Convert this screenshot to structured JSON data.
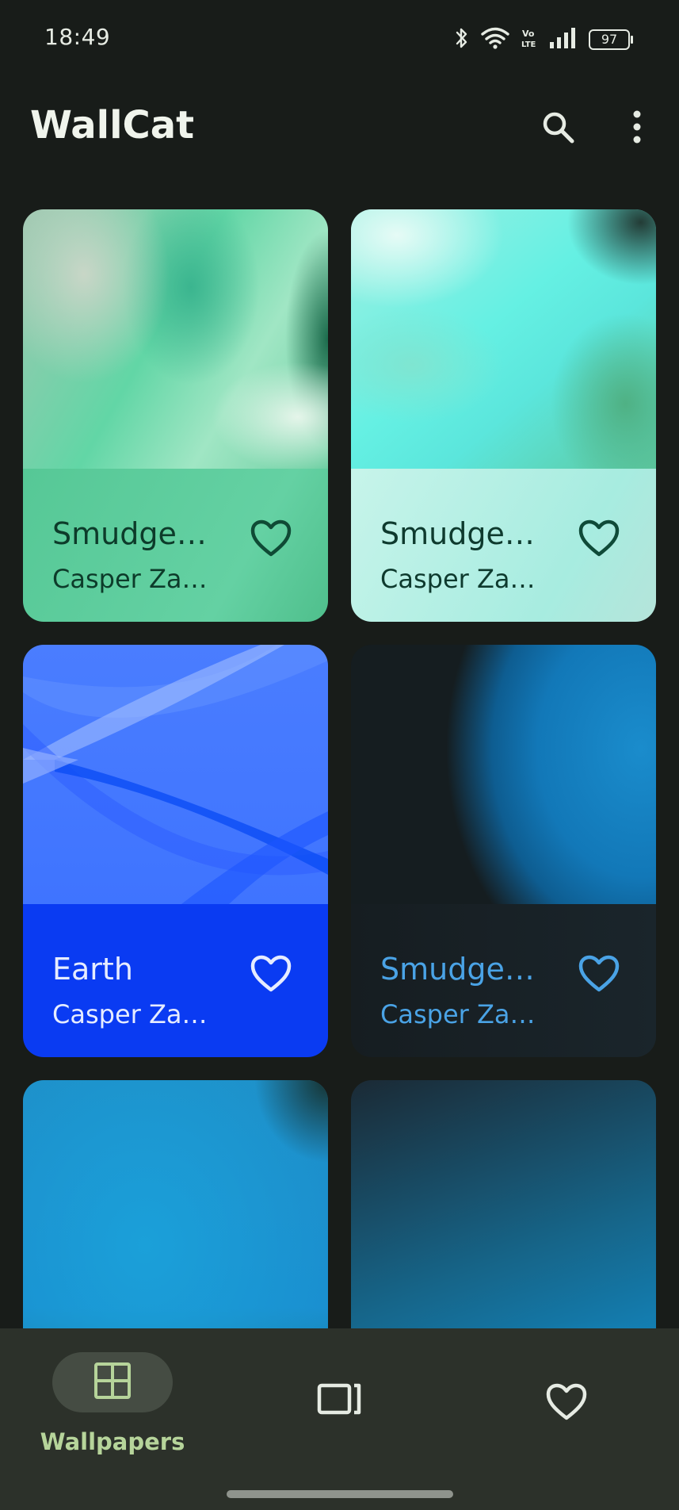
{
  "status_bar": {
    "time": "18:49",
    "battery": "97",
    "network": "Vo LTE",
    "icons": [
      "bluetooth-icon",
      "wifi-icon",
      "volte-icon",
      "signal-icon",
      "battery-icon"
    ]
  },
  "app_bar": {
    "title": "WallCat",
    "actions": [
      "search-icon",
      "more-vert-icon"
    ]
  },
  "cards": [
    {
      "title": "Smudge…",
      "author": "Casper Za…",
      "favorite": false
    },
    {
      "title": "Smudge…",
      "author": "Casper Za…",
      "favorite": false
    },
    {
      "title": "Earth",
      "author": "Casper Za…",
      "favorite": false
    },
    {
      "title": "Smudge…",
      "author": "Casper Za…",
      "favorite": false
    }
  ],
  "bottom_nav": {
    "items": [
      {
        "label": "Wallpapers",
        "icon": "grid-icon",
        "selected": true
      },
      {
        "label": "",
        "icon": "tablet-icon",
        "selected": false
      },
      {
        "label": "",
        "icon": "heart-icon",
        "selected": false
      }
    ]
  },
  "colors": {
    "background": "#181c19",
    "nav_background": "#2c312a",
    "nav_selected": "#b6d49a"
  }
}
